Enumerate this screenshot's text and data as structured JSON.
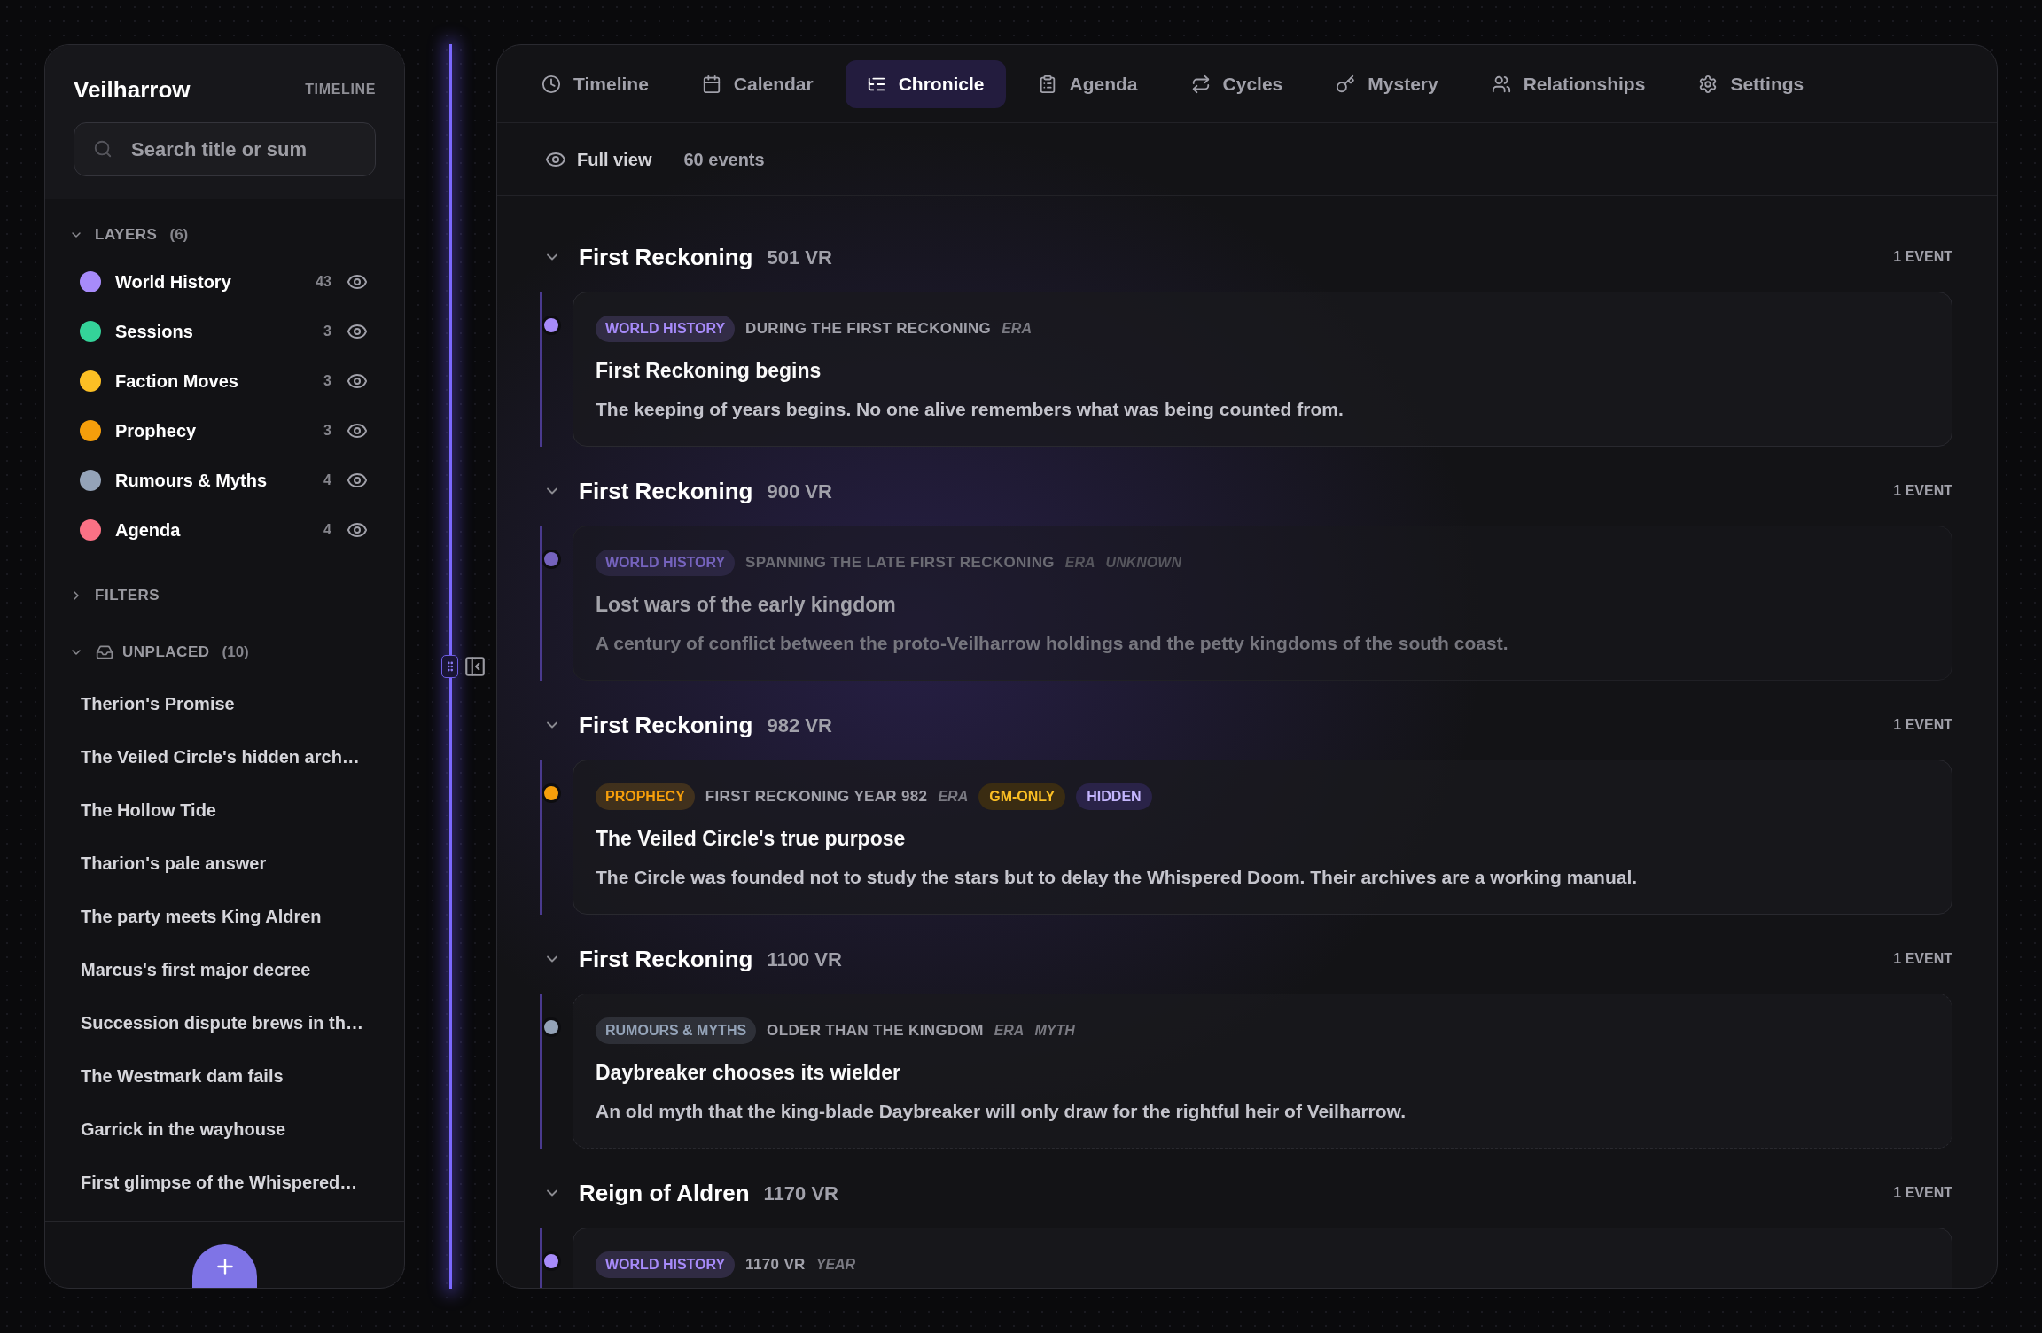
{
  "sidebar": {
    "title": "Veilharrow",
    "subtitle": "TIMELINE",
    "search": {
      "placeholder": "Search title or sum"
    },
    "layers": {
      "label": "LAYERS",
      "count": "(6)",
      "expanded": true,
      "items": [
        {
          "name": "World History",
          "count": "43",
          "color": "#a78bfa",
          "visible": true
        },
        {
          "name": "Sessions",
          "count": "3",
          "color": "#34d399",
          "visible": true
        },
        {
          "name": "Faction Moves",
          "count": "3",
          "color": "#fbbf24",
          "visible": true
        },
        {
          "name": "Prophecy",
          "count": "3",
          "color": "#f59e0b",
          "visible": true
        },
        {
          "name": "Rumours & Myths",
          "count": "4",
          "color": "#94a3b8",
          "visible": true
        },
        {
          "name": "Agenda",
          "count": "4",
          "color": "#fb7185",
          "visible": true
        }
      ]
    },
    "filters": {
      "label": "FILTERS",
      "expanded": false
    },
    "unplaced": {
      "label": "UNPLACED",
      "count": "(10)",
      "expanded": true,
      "items": [
        "Therion's Promise",
        "The Veiled Circle's hidden arch…",
        "The Hollow Tide",
        "Tharion's pale answer",
        "The party meets King Aldren",
        "Marcus's first major decree",
        "Succession dispute brews in th…",
        "The Westmark dam fails",
        "Garrick in the wayhouse",
        "First glimpse of the Whispered…"
      ]
    }
  },
  "tabs": [
    {
      "label": "Timeline",
      "selected": false
    },
    {
      "label": "Calendar",
      "selected": false
    },
    {
      "label": "Chronicle",
      "selected": true
    },
    {
      "label": "Agenda",
      "selected": false
    },
    {
      "label": "Cycles",
      "selected": false
    },
    {
      "label": "Mystery",
      "selected": false
    },
    {
      "label": "Relationships",
      "selected": false
    },
    {
      "label": "Settings",
      "selected": false
    }
  ],
  "toolbar": {
    "view_mode": "Full view",
    "event_count": "60 events"
  },
  "groups": [
    {
      "title": "First Reckoning",
      "year": "501 VR",
      "count": "1 EVENT",
      "expanded": true,
      "events": [
        {
          "layer": "WORLD HISTORY",
          "color": "#a78bfa",
          "date": "DURING THE FIRST RECKONING",
          "qualifiers": [
            "ERA"
          ],
          "title": "First Reckoning begins",
          "summary": "The keeping of years begins. No one alive remembers what was being counted from.",
          "dimmed": false,
          "dashed": false
        }
      ]
    },
    {
      "title": "First Reckoning",
      "year": "900 VR",
      "count": "1 EVENT",
      "expanded": true,
      "events": [
        {
          "layer": "WORLD HISTORY",
          "color": "#7563bd",
          "date": "SPANNING THE LATE FIRST RECKONING",
          "qualifiers": [
            "ERA",
            "UNKNOWN"
          ],
          "title": "Lost wars of the early kingdom",
          "summary": "A century of conflict between the proto-Veilharrow holdings and the petty kingdoms of the south coast.",
          "dimmed": true,
          "dashed": false
        }
      ]
    },
    {
      "title": "First Reckoning",
      "year": "982 VR",
      "count": "1 EVENT",
      "expanded": true,
      "events": [
        {
          "layer": "PROPHECY",
          "color": "#f59e0b",
          "date": "FIRST RECKONING YEAR 982",
          "qualifiers": [
            "ERA"
          ],
          "badges": [
            {
              "label": "GM-ONLY",
              "kind": "gm"
            },
            {
              "label": "HIDDEN",
              "kind": "hidden"
            }
          ],
          "title": "The Veiled Circle's true purpose",
          "summary": "The Circle was founded not to study the stars but to delay the Whispered Doom. Their archives are a working manual.",
          "dimmed": false,
          "dashed": false
        }
      ]
    },
    {
      "title": "First Reckoning",
      "year": "1100 VR",
      "count": "1 EVENT",
      "expanded": true,
      "events": [
        {
          "layer": "RUMOURS & MYTHS",
          "color": "#94a3b8",
          "date": "OLDER THAN THE KINGDOM",
          "qualifiers": [
            "ERA",
            "MYTH"
          ],
          "title": "Daybreaker chooses its wielder",
          "summary": "An old myth that the king-blade Daybreaker will only draw for the rightful heir of Veilharrow.",
          "dimmed": false,
          "dashed": true
        }
      ]
    },
    {
      "title": "Reign of Aldren",
      "year": "1170 VR",
      "count": "1 EVENT",
      "expanded": true,
      "events": [
        {
          "layer": "WORLD HISTORY",
          "color": "#a78bfa",
          "date": "1170 VR",
          "qualifiers": [
            "YEAR"
          ],
          "dimmed": false,
          "dashed": false
        }
      ]
    }
  ]
}
